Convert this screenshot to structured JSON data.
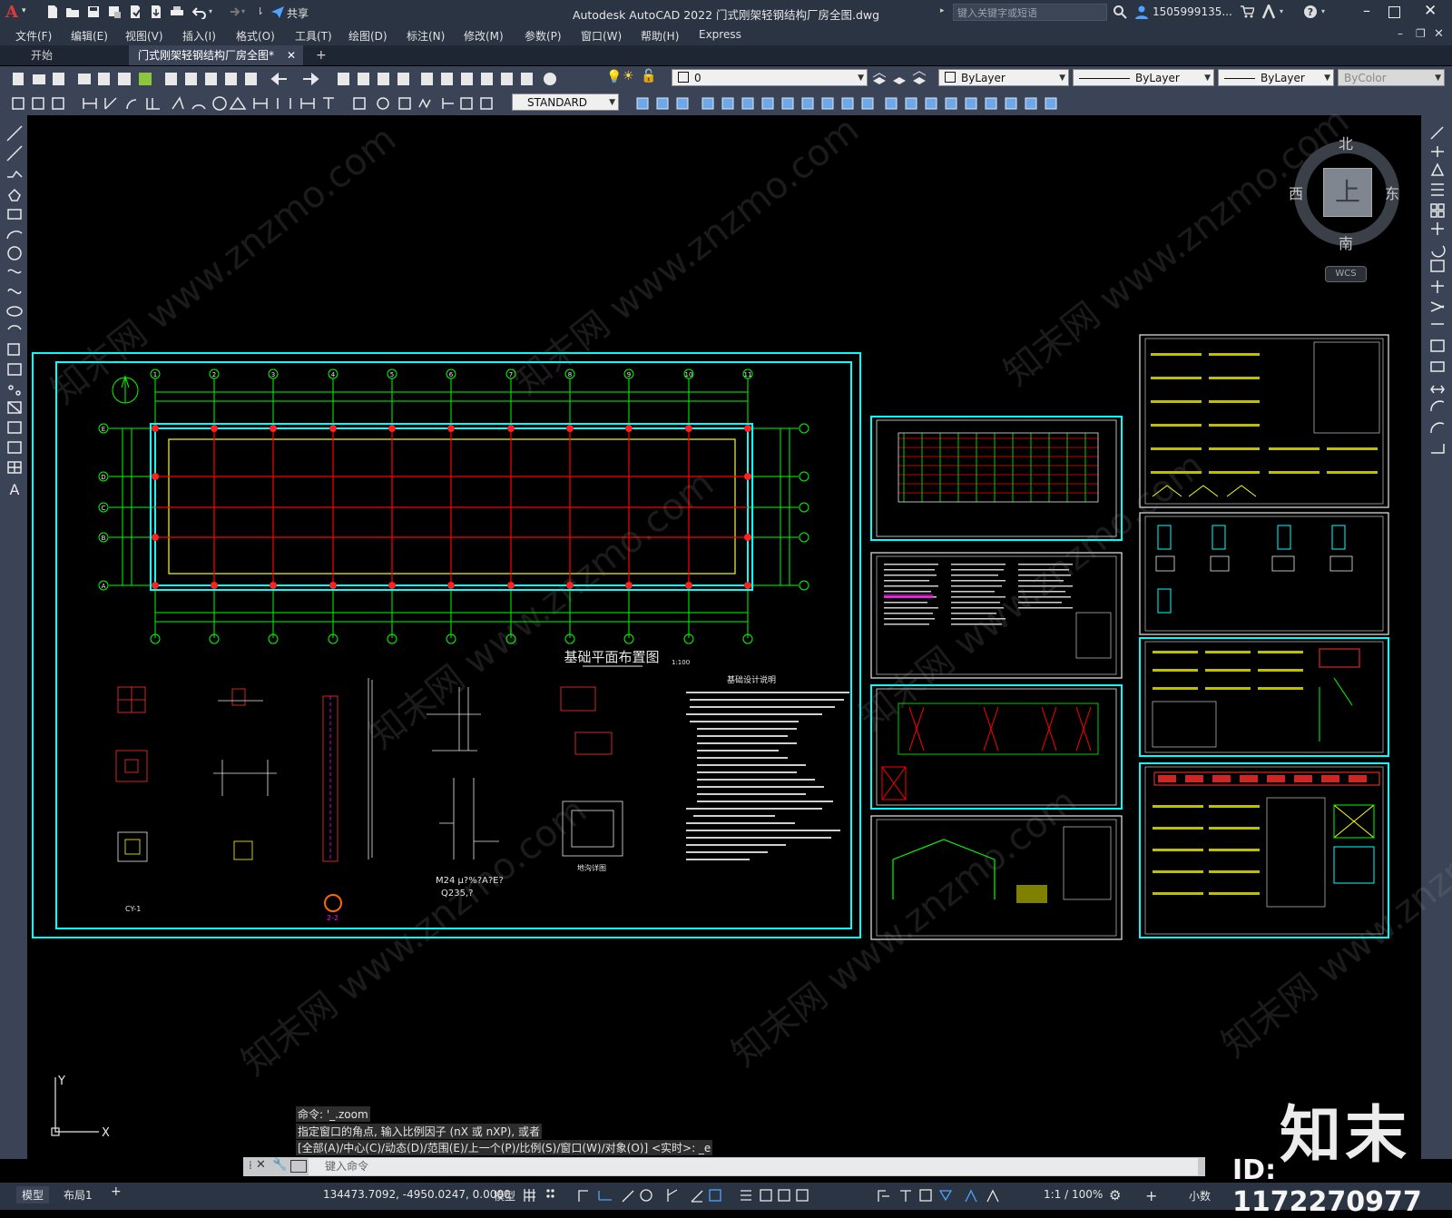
{
  "app": {
    "title": "Autodesk AutoCAD 2022    门式刚架轻钢结构厂房全图.dwg",
    "logo": "A",
    "share_label": "共享",
    "search_placeholder": "键入关键字或短语",
    "user": "1505999135...",
    "window_controls": [
      "minimize-icon",
      "maximize-icon",
      "close-icon"
    ]
  },
  "menu": [
    "文件(F)",
    "编辑(E)",
    "视图(V)",
    "插入(I)",
    "格式(O)",
    "工具(T)",
    "绘图(D)",
    "标注(N)",
    "修改(M)",
    "参数(P)",
    "窗口(W)",
    "帮助(H)",
    "Express"
  ],
  "tabs": {
    "start": "开始",
    "drawing": "门式刚架轻钢结构厂房全图*",
    "add": "+"
  },
  "toolbar": {
    "layer_value": "0",
    "color_value": "ByLayer",
    "linetype_value": "ByLayer",
    "lineweight_value": "ByLayer",
    "plotstyle_value": "ByColor",
    "textstyle_value": "STANDARD"
  },
  "viewcube": {
    "north": "北",
    "south": "南",
    "east": "东",
    "west": "西",
    "face": "上",
    "wcs": "WCS"
  },
  "drawing": {
    "main_title": "基础平面布置图",
    "main_scale": "1:100",
    "notes_title": "基础设计说明",
    "grid_numbers": [
      "1",
      "2",
      "3",
      "4",
      "5",
      "6",
      "7",
      "8",
      "9",
      "10",
      "11"
    ],
    "grid_letters": [
      "E",
      "D",
      "C",
      "B",
      "A"
    ],
    "label_cy1": "CY-1",
    "label_m24": "M24 μ?%?A?E?",
    "label_q235": "Q235,?",
    "label_ditu": "地沟详图",
    "label_22": "2-2"
  },
  "ucs": {
    "x": "X",
    "y": "Y"
  },
  "command": {
    "history": [
      "命令: '_.zoom",
      "指定窗口的角点, 输入比例因子 (nX 或 nXP), 或者",
      "[全部(A)/中心(C)/动态(D)/范围(E)/上一个(P)/比例(S)/窗口(W)/对象(O)] <实时>: _e"
    ],
    "placeholder": "键入命令"
  },
  "status": {
    "layout_tabs": [
      "模型",
      "布局1"
    ],
    "add_layout": "+",
    "coords": "134473.7092, -4950.0247, 0.0000",
    "mode": "模型",
    "scale": "1:1 / 100%",
    "units": "小数"
  },
  "watermark": {
    "brand": "知末",
    "id": "ID: 1172270977",
    "text": "知末网 www.znzmo.com"
  },
  "colors": {
    "titlebar": "#2b3443",
    "toolbar": "#3b4456",
    "cad_cyan": "#00ffff",
    "cad_green": "#00ff00",
    "cad_red": "#ff0000",
    "cad_yellow": "#ffff00",
    "cad_magenta": "#ff00ff"
  }
}
